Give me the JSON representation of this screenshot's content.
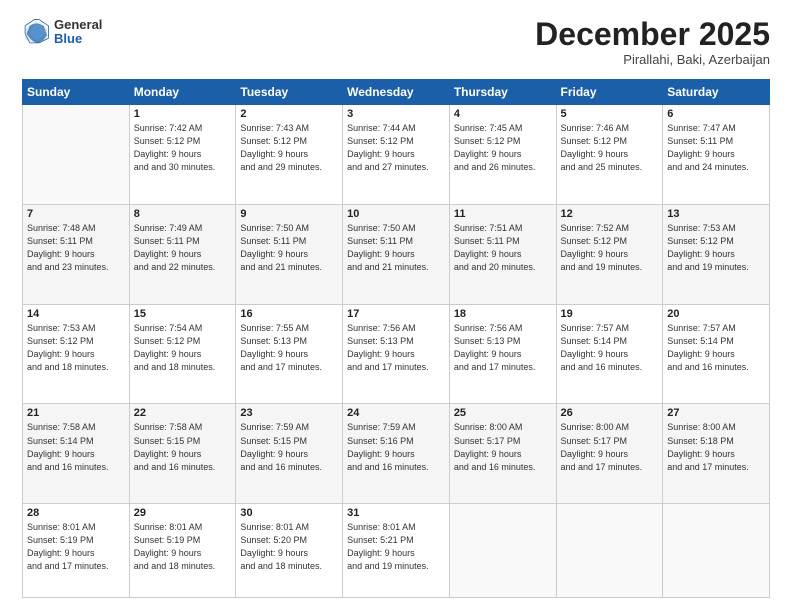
{
  "header": {
    "logo_general": "General",
    "logo_blue": "Blue",
    "month_title": "December 2025",
    "location": "Pirallahi, Baki, Azerbaijan"
  },
  "days_of_week": [
    "Sunday",
    "Monday",
    "Tuesday",
    "Wednesday",
    "Thursday",
    "Friday",
    "Saturday"
  ],
  "weeks": [
    [
      {
        "day": "",
        "sunrise": "",
        "sunset": "",
        "daylight": ""
      },
      {
        "day": "1",
        "sunrise": "Sunrise: 7:42 AM",
        "sunset": "Sunset: 5:12 PM",
        "daylight": "Daylight: 9 hours and 30 minutes."
      },
      {
        "day": "2",
        "sunrise": "Sunrise: 7:43 AM",
        "sunset": "Sunset: 5:12 PM",
        "daylight": "Daylight: 9 hours and 29 minutes."
      },
      {
        "day": "3",
        "sunrise": "Sunrise: 7:44 AM",
        "sunset": "Sunset: 5:12 PM",
        "daylight": "Daylight: 9 hours and 27 minutes."
      },
      {
        "day": "4",
        "sunrise": "Sunrise: 7:45 AM",
        "sunset": "Sunset: 5:12 PM",
        "daylight": "Daylight: 9 hours and 26 minutes."
      },
      {
        "day": "5",
        "sunrise": "Sunrise: 7:46 AM",
        "sunset": "Sunset: 5:12 PM",
        "daylight": "Daylight: 9 hours and 25 minutes."
      },
      {
        "day": "6",
        "sunrise": "Sunrise: 7:47 AM",
        "sunset": "Sunset: 5:11 PM",
        "daylight": "Daylight: 9 hours and 24 minutes."
      }
    ],
    [
      {
        "day": "7",
        "sunrise": "Sunrise: 7:48 AM",
        "sunset": "Sunset: 5:11 PM",
        "daylight": "Daylight: 9 hours and 23 minutes."
      },
      {
        "day": "8",
        "sunrise": "Sunrise: 7:49 AM",
        "sunset": "Sunset: 5:11 PM",
        "daylight": "Daylight: 9 hours and 22 minutes."
      },
      {
        "day": "9",
        "sunrise": "Sunrise: 7:50 AM",
        "sunset": "Sunset: 5:11 PM",
        "daylight": "Daylight: 9 hours and 21 minutes."
      },
      {
        "day": "10",
        "sunrise": "Sunrise: 7:50 AM",
        "sunset": "Sunset: 5:11 PM",
        "daylight": "Daylight: 9 hours and 21 minutes."
      },
      {
        "day": "11",
        "sunrise": "Sunrise: 7:51 AM",
        "sunset": "Sunset: 5:11 PM",
        "daylight": "Daylight: 9 hours and 20 minutes."
      },
      {
        "day": "12",
        "sunrise": "Sunrise: 7:52 AM",
        "sunset": "Sunset: 5:12 PM",
        "daylight": "Daylight: 9 hours and 19 minutes."
      },
      {
        "day": "13",
        "sunrise": "Sunrise: 7:53 AM",
        "sunset": "Sunset: 5:12 PM",
        "daylight": "Daylight: 9 hours and 19 minutes."
      }
    ],
    [
      {
        "day": "14",
        "sunrise": "Sunrise: 7:53 AM",
        "sunset": "Sunset: 5:12 PM",
        "daylight": "Daylight: 9 hours and 18 minutes."
      },
      {
        "day": "15",
        "sunrise": "Sunrise: 7:54 AM",
        "sunset": "Sunset: 5:12 PM",
        "daylight": "Daylight: 9 hours and 18 minutes."
      },
      {
        "day": "16",
        "sunrise": "Sunrise: 7:55 AM",
        "sunset": "Sunset: 5:13 PM",
        "daylight": "Daylight: 9 hours and 17 minutes."
      },
      {
        "day": "17",
        "sunrise": "Sunrise: 7:56 AM",
        "sunset": "Sunset: 5:13 PM",
        "daylight": "Daylight: 9 hours and 17 minutes."
      },
      {
        "day": "18",
        "sunrise": "Sunrise: 7:56 AM",
        "sunset": "Sunset: 5:13 PM",
        "daylight": "Daylight: 9 hours and 17 minutes."
      },
      {
        "day": "19",
        "sunrise": "Sunrise: 7:57 AM",
        "sunset": "Sunset: 5:14 PM",
        "daylight": "Daylight: 9 hours and 16 minutes."
      },
      {
        "day": "20",
        "sunrise": "Sunrise: 7:57 AM",
        "sunset": "Sunset: 5:14 PM",
        "daylight": "Daylight: 9 hours and 16 minutes."
      }
    ],
    [
      {
        "day": "21",
        "sunrise": "Sunrise: 7:58 AM",
        "sunset": "Sunset: 5:14 PM",
        "daylight": "Daylight: 9 hours and 16 minutes."
      },
      {
        "day": "22",
        "sunrise": "Sunrise: 7:58 AM",
        "sunset": "Sunset: 5:15 PM",
        "daylight": "Daylight: 9 hours and 16 minutes."
      },
      {
        "day": "23",
        "sunrise": "Sunrise: 7:59 AM",
        "sunset": "Sunset: 5:15 PM",
        "daylight": "Daylight: 9 hours and 16 minutes."
      },
      {
        "day": "24",
        "sunrise": "Sunrise: 7:59 AM",
        "sunset": "Sunset: 5:16 PM",
        "daylight": "Daylight: 9 hours and 16 minutes."
      },
      {
        "day": "25",
        "sunrise": "Sunrise: 8:00 AM",
        "sunset": "Sunset: 5:17 PM",
        "daylight": "Daylight: 9 hours and 16 minutes."
      },
      {
        "day": "26",
        "sunrise": "Sunrise: 8:00 AM",
        "sunset": "Sunset: 5:17 PM",
        "daylight": "Daylight: 9 hours and 17 minutes."
      },
      {
        "day": "27",
        "sunrise": "Sunrise: 8:00 AM",
        "sunset": "Sunset: 5:18 PM",
        "daylight": "Daylight: 9 hours and 17 minutes."
      }
    ],
    [
      {
        "day": "28",
        "sunrise": "Sunrise: 8:01 AM",
        "sunset": "Sunset: 5:19 PM",
        "daylight": "Daylight: 9 hours and 17 minutes."
      },
      {
        "day": "29",
        "sunrise": "Sunrise: 8:01 AM",
        "sunset": "Sunset: 5:19 PM",
        "daylight": "Daylight: 9 hours and 18 minutes."
      },
      {
        "day": "30",
        "sunrise": "Sunrise: 8:01 AM",
        "sunset": "Sunset: 5:20 PM",
        "daylight": "Daylight: 9 hours and 18 minutes."
      },
      {
        "day": "31",
        "sunrise": "Sunrise: 8:01 AM",
        "sunset": "Sunset: 5:21 PM",
        "daylight": "Daylight: 9 hours and 19 minutes."
      },
      {
        "day": "",
        "sunrise": "",
        "sunset": "",
        "daylight": ""
      },
      {
        "day": "",
        "sunrise": "",
        "sunset": "",
        "daylight": ""
      },
      {
        "day": "",
        "sunrise": "",
        "sunset": "",
        "daylight": ""
      }
    ]
  ]
}
